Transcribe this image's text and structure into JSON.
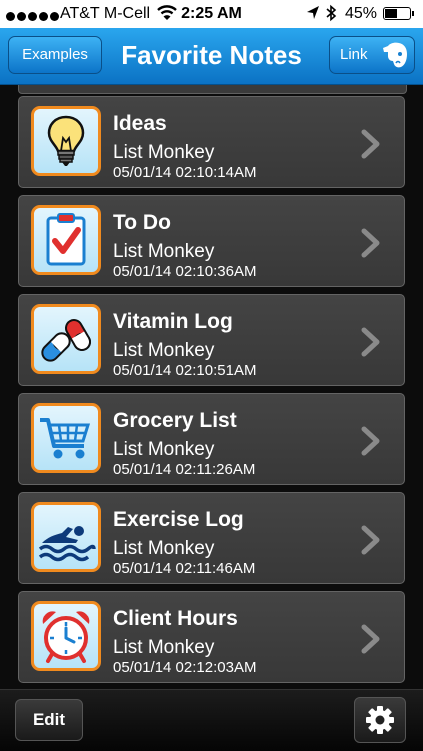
{
  "status_bar": {
    "carrier": "AT&T M-Cell",
    "time": "2:25 AM",
    "battery_percent": "45%",
    "battery_level": 0.45
  },
  "nav": {
    "examples_label": "Examples",
    "title": "Favorite Notes",
    "link_label": "Link"
  },
  "notes": [
    {
      "title": "Ideas",
      "subtitle": "List Monkey",
      "date": "05/01/14 02:10:14AM",
      "icon": "lightbulb-icon"
    },
    {
      "title": "To Do",
      "subtitle": "List Monkey",
      "date": "05/01/14 02:10:36AM",
      "icon": "clipboard-check-icon"
    },
    {
      "title": "Vitamin Log",
      "subtitle": "List Monkey",
      "date": "05/01/14 02:10:51AM",
      "icon": "pills-icon"
    },
    {
      "title": "Grocery List",
      "subtitle": "List Monkey",
      "date": "05/01/14 02:11:26AM",
      "icon": "shopping-cart-icon"
    },
    {
      "title": "Exercise Log",
      "subtitle": "List Monkey",
      "date": "05/01/14 02:11:46AM",
      "icon": "swimmer-icon"
    },
    {
      "title": "Client Hours",
      "subtitle": "List Monkey",
      "date": "05/01/14 02:12:03AM",
      "icon": "alarm-clock-icon"
    }
  ],
  "toolbar": {
    "edit_label": "Edit",
    "settings_icon": "gear-icon"
  },
  "colors": {
    "nav_blue": "#1a8fdc",
    "icon_border_orange": "#f08a1e",
    "row_gray": "#404040",
    "background": "#0c0c0c"
  }
}
